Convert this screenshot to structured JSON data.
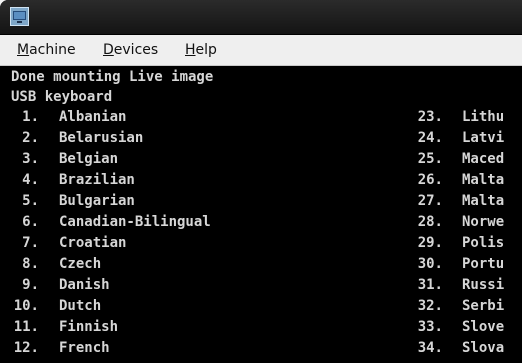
{
  "menubar": {
    "items": [
      {
        "label": "Machine",
        "mnemonic": "M",
        "rest": "achine"
      },
      {
        "label": "Devices",
        "mnemonic": "D",
        "rest": "evices"
      },
      {
        "label": "Help",
        "mnemonic": "H",
        "rest": "elp"
      }
    ]
  },
  "terminal": {
    "lines": [
      "Done mounting Live image",
      "USB keyboard"
    ],
    "left_column": [
      {
        "num": "1.",
        "lang": "Albanian"
      },
      {
        "num": "2.",
        "lang": "Belarusian"
      },
      {
        "num": "3.",
        "lang": "Belgian"
      },
      {
        "num": "4.",
        "lang": "Brazilian"
      },
      {
        "num": "5.",
        "lang": "Bulgarian"
      },
      {
        "num": "6.",
        "lang": "Canadian-Bilingual"
      },
      {
        "num": "7.",
        "lang": "Croatian"
      },
      {
        "num": "8.",
        "lang": "Czech"
      },
      {
        "num": "9.",
        "lang": "Danish"
      },
      {
        "num": "10.",
        "lang": "Dutch"
      },
      {
        "num": "11.",
        "lang": "Finnish"
      },
      {
        "num": "12.",
        "lang": "French"
      }
    ],
    "right_column": [
      {
        "num": "23.",
        "lang": "Lithu"
      },
      {
        "num": "24.",
        "lang": "Latvi"
      },
      {
        "num": "25.",
        "lang": "Maced"
      },
      {
        "num": "26.",
        "lang": "Malta"
      },
      {
        "num": "27.",
        "lang": "Malta"
      },
      {
        "num": "28.",
        "lang": "Norwe"
      },
      {
        "num": "29.",
        "lang": "Polis"
      },
      {
        "num": "30.",
        "lang": "Portu"
      },
      {
        "num": "31.",
        "lang": "Russi"
      },
      {
        "num": "32.",
        "lang": "Serbi"
      },
      {
        "num": "33.",
        "lang": "Slove"
      },
      {
        "num": "34.",
        "lang": "Slova"
      }
    ]
  },
  "colors": {
    "terminal_bg": "#000000",
    "terminal_text": "#d6d6d6",
    "menubar_bg": "#efefef",
    "titlebar_bg": "#1c1c1c"
  }
}
